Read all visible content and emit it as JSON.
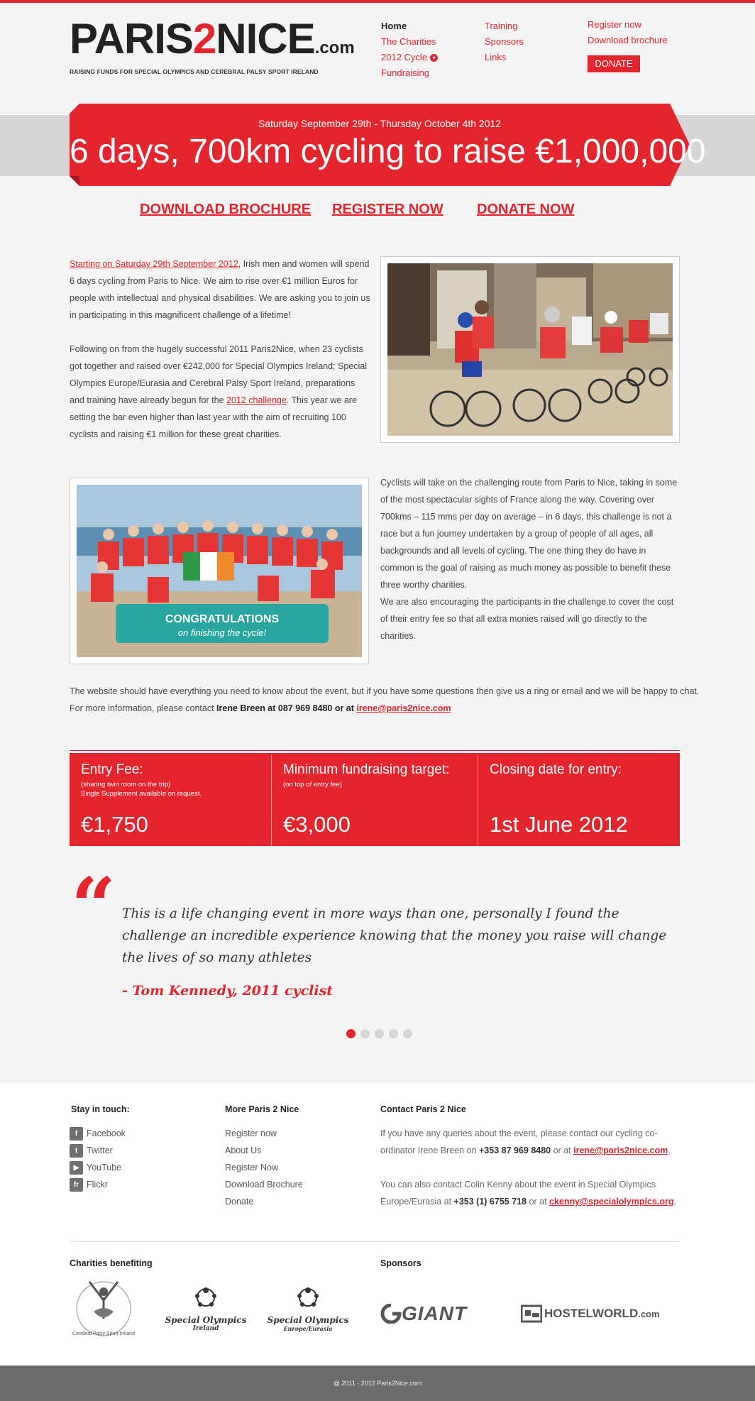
{
  "brand": {
    "left": "PARIS",
    "two": "2",
    "right": "NICE",
    "suffix": ".com",
    "tagline": "RAISING FUNDS FOR SPECIAL OLYMPICS AND CEREBRAL PALSY SPORT IRELAND"
  },
  "nav": {
    "col1": [
      "Home",
      "The Charities",
      "2012 Cycle",
      "Fundraising"
    ],
    "col2": [
      "Training",
      "Sponsors",
      "Links"
    ],
    "col3": [
      "Register now",
      "Download brochure"
    ],
    "donate": "DONATE"
  },
  "banner": {
    "date": "Saturday September 29th - Thursday October 4th 2012",
    "headline": "6 days, 700km cycling to raise €1,000,000"
  },
  "cta": {
    "brochure": "DOWNLOAD BROCHURE",
    "register": "REGISTER NOW",
    "donate": "DONATE NOW"
  },
  "intro": {
    "p1_link": "Starting on Saturday 29th September 2012",
    "p1_rest": ", Irish men and women will spend 6 days cycling from Paris to Nice. We aim to rise over €1 million Euros for people with intellectual and physical disabilities. We are asking you to join us in participating in this magnificent challenge of a lifetime!",
    "p2_pre": "Following on from the hugely successful 2011 Paris2Nice, when 23 cyclists got together and raised over €242,000 for Special Olympics Ireland; Special Olympics Europe/Eurasia and Cerebral Palsy Sport Ireland, preparations and training have already begun for the ",
    "p2_link": "2012 challenge",
    "p2_post": ". This year we are setting the bar even higher than last year with the aim of recruiting 100 cyclists and raising €1 million for these great charities."
  },
  "route": {
    "p1": "Cyclists will take on the challenging route from Paris to Nice, taking in some of the most spectacular sights of France along the way. Covering over 700kms – 115 mms per day on average – in 6 days, this challenge is not a race but a fun journey undertaken by a group of people of all ages, all backgrounds and all levels of cycling. The one thing they do have in common is the goal of raising  as much money as possible to benefit these three worthy charities.",
    "p2": "We are also encouraging the participants in the challenge to cover the cost of their entry fee so that all extra monies raised will go directly to the charities."
  },
  "banner_photo_text": {
    "line1": "CONGRATULATIONS",
    "line2": "on finishing the cycle!"
  },
  "contact": {
    "line1": "The website should have everything you need to know about the event, but if you have some questions then give us a ring or email and we will be happy to chat.",
    "line2_pre": "For more information, please contact ",
    "line2_bold": "Irene Breen at 087 969 8480 or at ",
    "email": "irene@paris2nice.com"
  },
  "info": [
    {
      "title": "Entry Fee:",
      "sub1": "(sharing twin room on the trip)",
      "sub2": "Single Supplement available on request.",
      "value": "€1,750"
    },
    {
      "title": "Minimum fundraising target:",
      "sub1": "(on top of entry fee)",
      "sub2": "",
      "value": "€3,000"
    },
    {
      "title": "Closing date for entry:",
      "sub1": "",
      "sub2": "",
      "value": "1st June 2012"
    }
  ],
  "quote": {
    "mark": "“",
    "text": "This is a life changing event in more ways than one, personally I found the challenge  an incredible experience knowing that the money you raise will change the lives of so many athletes",
    "author": "- Tom Kennedy, 2011 cyclist",
    "active_slide": 1,
    "slide_count": 5
  },
  "footer": {
    "stay_title": "Stay in touch:",
    "social": [
      {
        "icon": "facebook-icon",
        "glyph": "f",
        "label": "Facebook"
      },
      {
        "icon": "twitter-icon",
        "glyph": "t",
        "label": "Twitter"
      },
      {
        "icon": "youtube-icon",
        "glyph": "▶",
        "label": "YouTube"
      },
      {
        "icon": "flickr-icon",
        "glyph": "fr",
        "label": "Flickr"
      }
    ],
    "more_title": "More Paris 2 Nice",
    "more_links": [
      "Register now",
      "About Us",
      "Register Now",
      "Download Brochure",
      "Donate"
    ],
    "contact_title": "Contact Paris 2 Nice",
    "contact_p1_pre": "If you have any queries about the event, please contact our cycling co-ordinator Irene Breen on ",
    "contact_p1_phone": "+353 87 969 8480",
    "contact_p1_mid": " or at ",
    "contact_p1_email": "irene@paris2nice.com",
    "contact_p2_pre": "You can also contact Colin Kenny about the event in Special Olympics Europe/Eurasia at ",
    "contact_p2_phone": "+353 (1) 6755 718",
    "contact_p2_mid": " or at ",
    "contact_p2_email": "ckenny@specialolympics.org",
    "charities_title": "Charities benefiting",
    "charities": [
      {
        "name": "Cerebral Palsy Sport Ireland"
      },
      {
        "name": "Special Olympics",
        "sub": "Ireland"
      },
      {
        "name": "Special Olympics",
        "sub": "Europe/Eurasia"
      }
    ],
    "sponsors_title": "Sponsors",
    "sponsors": [
      "GIANT",
      "HOSTELWORLD",
      ".com"
    ],
    "copyright": "@ 2011 - 2012 Paris2Nice.com"
  },
  "colors": {
    "accent": "#e4252d",
    "footer_bar": "#6b6b6b"
  }
}
